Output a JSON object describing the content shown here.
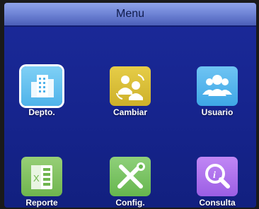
{
  "title": "Menu",
  "tiles": [
    {
      "label": "Depto.",
      "icon": "building-icon",
      "selected": true
    },
    {
      "label": "Cambiar",
      "icon": "swap-users-icon",
      "selected": false
    },
    {
      "label": "Usuario",
      "icon": "users-icon",
      "selected": false
    },
    {
      "label": "Reporte",
      "icon": "excel-icon",
      "selected": false
    },
    {
      "label": "Config.",
      "icon": "tools-icon",
      "selected": false
    },
    {
      "label": "Consulta",
      "icon": "info-search-icon",
      "selected": false
    }
  ]
}
